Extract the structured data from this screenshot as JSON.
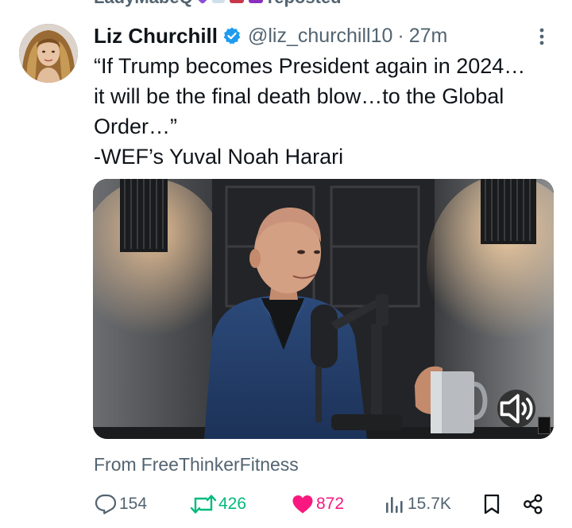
{
  "repost_banner": {
    "text": "LadyMabeQ",
    "suffix": "reposted"
  },
  "tweet": {
    "display_name": "Liz Churchill",
    "verified_icon": "verified-badge-icon",
    "handle": "@liz_churchill10",
    "separator": "·",
    "time": "27m",
    "more_icon": "more-vertical-icon",
    "text_lines": [
      "“If Trump becomes President again in 2024…",
      "it will be the final death blow…to the Global",
      "Order…”",
      "-WEF’s Yuval Noah Harari"
    ],
    "media": {
      "sound_icon": "speaker-icon"
    },
    "source": {
      "label": "From",
      "name": "FreeThinkerFitness"
    },
    "actions": {
      "replies": "154",
      "reposts": "426",
      "likes": "872",
      "views": "15.7K"
    }
  },
  "colors": {
    "accent_blue": "#1d9bf0",
    "repost_green": "#00ba7c",
    "like_pink": "#f91880",
    "secondary_text": "#536471"
  }
}
